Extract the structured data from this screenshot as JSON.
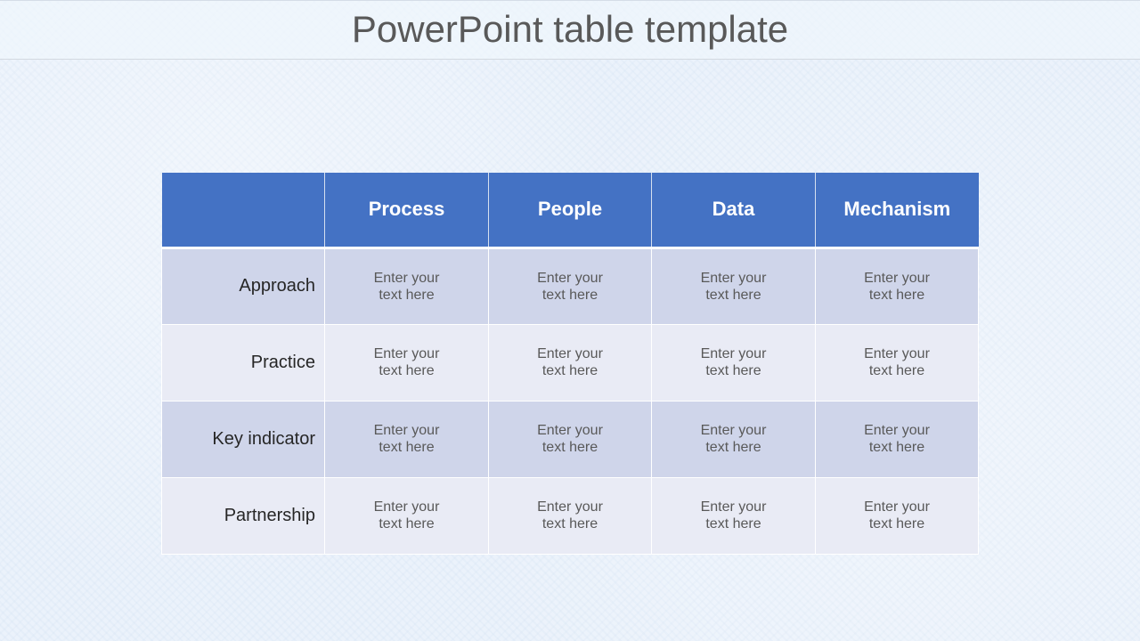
{
  "slide": {
    "title": "PowerPoint table template"
  },
  "table": {
    "header": [
      "",
      "Process",
      "People",
      "Data",
      "Mechanism"
    ],
    "rows": [
      {
        "label": "Approach",
        "cells": [
          "Enter your text here",
          "Enter your text here",
          "Enter your text here",
          "Enter your text here"
        ]
      },
      {
        "label": "Practice",
        "cells": [
          "Enter your text here",
          "Enter your text here",
          "Enter your text here",
          "Enter your text here"
        ]
      },
      {
        "label": "Key indicator",
        "cells": [
          "Enter your text here",
          "Enter your text here",
          "Enter your text here",
          "Enter your text here"
        ]
      },
      {
        "label": "Partnership",
        "cells": [
          "Enter your text here",
          "Enter your text here",
          "Enter your text here",
          "Enter your text here"
        ]
      }
    ]
  },
  "colors": {
    "header_bg": "#4472c4",
    "row_odd_bg": "#cfd5ea",
    "row_even_bg": "#e9ebf5",
    "title_text": "#595959"
  }
}
